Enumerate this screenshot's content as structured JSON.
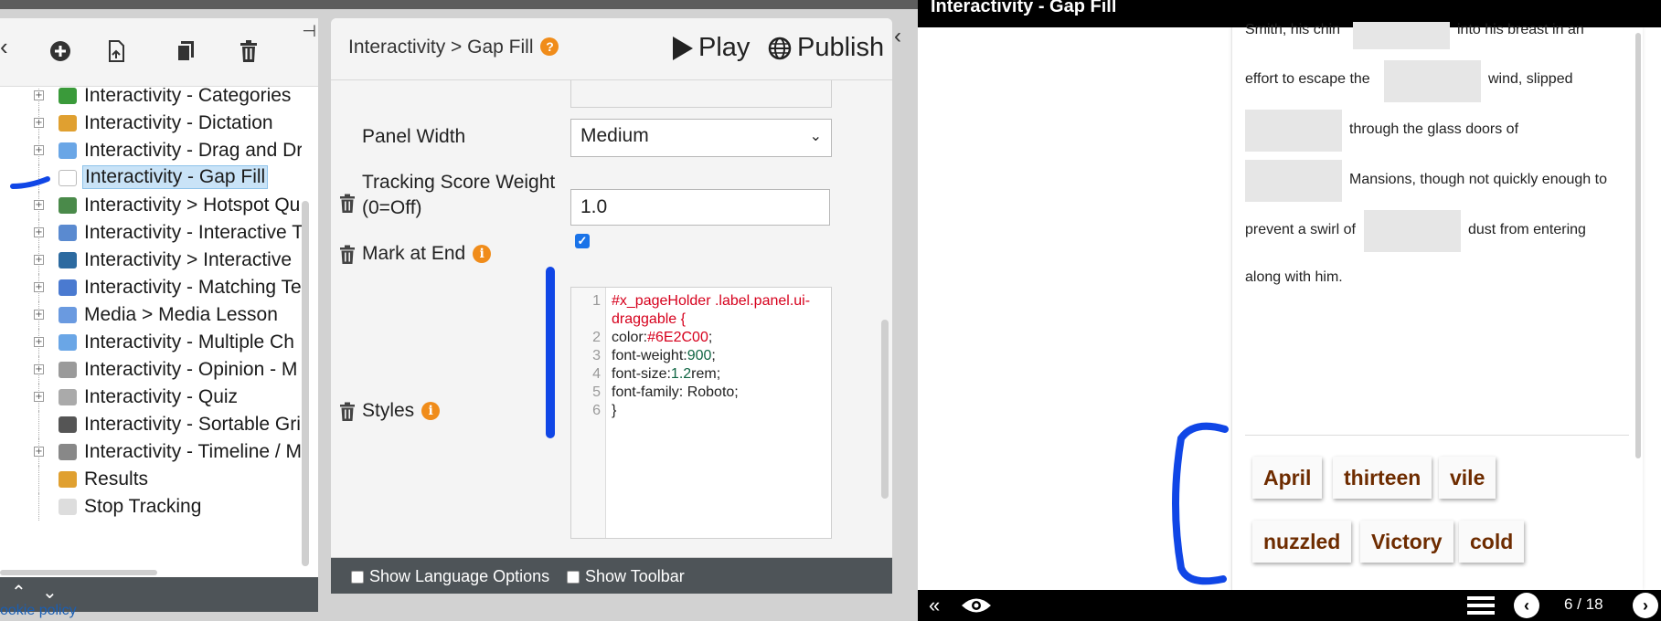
{
  "tree": {
    "items": [
      {
        "label": "Interactivity - Categories",
        "icon_color": "#3a9a3a",
        "plus": true
      },
      {
        "label": "Interactivity - Dictation",
        "icon_color": "#e0a030",
        "plus": true
      },
      {
        "label": "Interactivity - Drag and Dr",
        "icon_color": "#6aa6e6",
        "plus": true
      },
      {
        "label": "Interactivity - Gap Fill",
        "icon_color": "#ffffff",
        "plus": false,
        "selected": true
      },
      {
        "label": "Interactivity > Hotspot Qu",
        "icon_color": "#4a8a4a",
        "plus": true
      },
      {
        "label": "Interactivity - Interactive T",
        "icon_color": "#5a8ad0",
        "plus": true
      },
      {
        "label": "Interactivity > Interactive ",
        "icon_color": "#2c6aa0",
        "plus": true
      },
      {
        "label": "Interactivity - Matching Te",
        "icon_color": "#4a7ad0",
        "plus": true
      },
      {
        "label": "Media > Media Lesson",
        "icon_color": "#6a9ae0",
        "plus": true
      },
      {
        "label": "Interactivity - Multiple Ch",
        "icon_color": "#6aa6e6",
        "plus": true
      },
      {
        "label": "Interactivity - Opinion - M",
        "icon_color": "#9a9a9a",
        "plus": true
      },
      {
        "label": "Interactivity - Quiz",
        "icon_color": "#aaaaaa",
        "plus": true
      },
      {
        "label": "Interactivity - Sortable Gri",
        "icon_color": "#555555",
        "plus": false
      },
      {
        "label": "Interactivity - Timeline / M",
        "icon_color": "#888888",
        "plus": true
      },
      {
        "label": "Results",
        "icon_color": "#e0a030",
        "plus": false
      },
      {
        "label": "Stop Tracking",
        "icon_color": "#dddddd",
        "plus": false
      }
    ],
    "footer_up": "⌃",
    "footer_down": "⌄",
    "cookie_link": "ookie policy"
  },
  "props": {
    "breadcrumb": "Interactivity > Gap Fill",
    "help_glyph": "?",
    "play_label": "Play",
    "publish_label": "Publish",
    "panel_width_label": "Panel Width",
    "panel_width_value": "Medium",
    "tracking_label_1": "Tracking Score Weight",
    "tracking_label_2": "(0=Off)",
    "tracking_value": "1.0",
    "mark_label": "Mark at End",
    "mark_checked_glyph": "✓",
    "styles_label": "Styles",
    "info_glyph": "i",
    "code_lines": [
      {
        "n": "1",
        "a": "#x_pageHolder .label.panel.ui-",
        "b": "",
        "c": ""
      },
      {
        "n": "",
        "a": "draggable {",
        "b": "",
        "c": ""
      },
      {
        "n": "2",
        "a": "color:",
        "b": "#6E2C00",
        "c": ";"
      },
      {
        "n": "3",
        "a": "font-weight:",
        "b": "900",
        "c": ";"
      },
      {
        "n": "4",
        "a": "font-size:",
        "b": "1.2",
        "c": "rem;"
      },
      {
        "n": "5",
        "a": "font-family: Roboto;",
        "b": "",
        "c": ""
      },
      {
        "n": "6",
        "a": "}",
        "b": "",
        "c": ""
      }
    ],
    "show_language": "Show Language Options",
    "show_toolbar": "Show Toolbar"
  },
  "preview": {
    "title": "Interactivity - Gap Fill",
    "line1_a": "Smith, his chin",
    "line1_b": "into his breast in an",
    "line2_a": "effort to escape the",
    "line2_b": "wind, slipped",
    "line3": "through the glass doors of",
    "line4": "Mansions, though not quickly enough to",
    "line5_a": "prevent a swirl of",
    "line5_b": "dust from entering",
    "line6": "along with him.",
    "chips": [
      "April",
      "thirteen",
      "vile",
      "nuzzled",
      "Victory",
      "cold"
    ],
    "page_indicator": "6 / 18"
  }
}
